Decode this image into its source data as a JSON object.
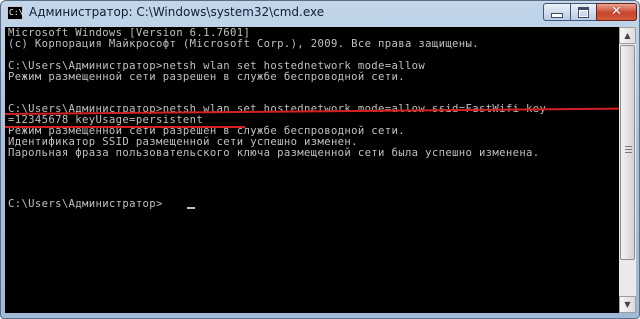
{
  "window": {
    "title": "Администратор: C:\\Windows\\system32\\cmd.exe",
    "icon_text": "C:\\",
    "controls": {
      "minimize": "minimize-icon",
      "maximize": "maximize-icon",
      "close": "close-icon"
    }
  },
  "console": {
    "lines": [
      "Microsoft Windows [Version 6.1.7601]",
      "(c) Корпорация Майкрософт (Microsoft Corp.), 2009. Все права защищены.",
      "C:\\Users\\Администратор>netsh wlan set hostednetwork mode=allow",
      "Режим размещенной сети разрешен в службе беспроводной сети.",
      "C:\\Users\\Администратор>netsh wlan set hostednetwork mode=allow ssid=FastWifi key",
      "=12345678 keyUsage=persistent",
      "Режим размещенной сети разрешен в службе беспроводной сети.",
      "Идентификатор SSID размещенной сети успешно изменен.",
      "Парольная фраза пользовательского ключа размещенной сети была успешно изменена.",
      "C:\\Users\\Администратор>"
    ]
  },
  "colors": {
    "console_bg": "#000000",
    "console_text": "#c0c0c0",
    "highlight_underline": "#d32020"
  }
}
